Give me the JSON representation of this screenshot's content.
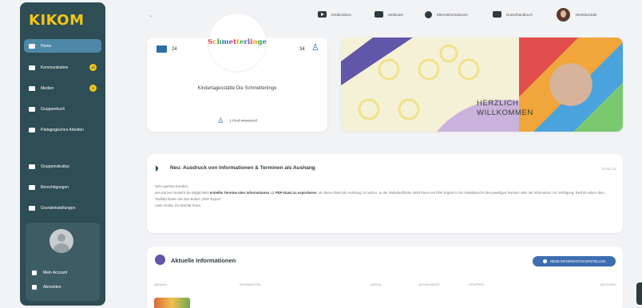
{
  "app": {
    "logo": "KIKOM"
  },
  "sidebar": {
    "items": [
      {
        "label": "Home",
        "active": true
      },
      {
        "label": "Kommunikation",
        "badge": "40"
      },
      {
        "label": "Medien",
        "badge": "5"
      },
      {
        "label": "Gruppenbuch"
      },
      {
        "label": "Pädagogisches Arbeiten"
      },
      {
        "label": "Gruppenstruktur"
      },
      {
        "label": "Berechtigungen"
      },
      {
        "label": "Grundeinstellungen"
      }
    ],
    "account": {
      "my_account": "Mein Account",
      "logout": "Abmelden"
    }
  },
  "topbar": {
    "links": [
      "Erklärvideos",
      "Webinare",
      "Elterninformationen",
      "Nutzerhandbuch",
      "Direktkontakt"
    ]
  },
  "kita": {
    "logo_text": "Schmetterlinge",
    "groups": "24",
    "children": "34",
    "name": "Kindertagesstätte Die Schmetterlinge",
    "present": "1 Kind anwesend"
  },
  "banner": {
    "line1": "HERZLICH",
    "line2": "WILLKOMMEN"
  },
  "news": {
    "title": "Neu: Ausdruck von Informationen & Terminen als Aushang",
    "time": "19.01.23",
    "greeting": "Sehr geehrte Kunden,",
    "body_pre": "seit Kurzem besteht die Möglichkeit",
    "body_b1": "erstellte Termine oder Informationen",
    "body_mid1": "als",
    "body_b2": "PDF-Datei zu exportieren",
    "body_mid2": ", um diese direkt als Aushang zu nutzen. In der Weboberfläche steht Ihnen ein PDF Export in der Detailansicht des jeweiligen Termins oder der Information zur Verfügung. Rechts neben dem Titelbild finden Sie den Button „PDF-Export“.",
    "signoff": "Viele Grüße, Ihr KIKOM Team"
  },
  "aktuell": {
    "title": "Aktuelle Informationen",
    "button": "NEUE INFORMATION ERSTELLEN",
    "columns": [
      "ANHANG",
      "INFORMATION",
      "DATUM",
      "AKTUALISIERT",
      "GRUPPEN",
      "AKTIONEN"
    ]
  },
  "colors": {
    "sidebar": "#2e4d55",
    "accent": "#f2c515",
    "active": "#4e88a8",
    "button": "#3e6db1"
  }
}
